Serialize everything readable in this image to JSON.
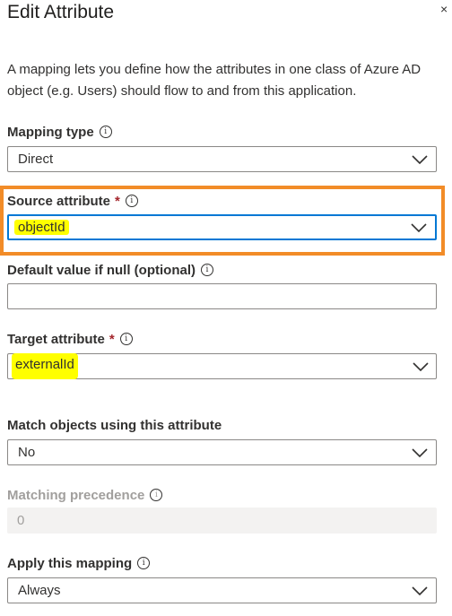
{
  "header": {
    "title": "Edit Attribute",
    "close_symbol": "×"
  },
  "description": "A mapping lets you define how the attributes in one class of Azure AD object (e.g. Users) should flow to and from this application.",
  "fields": {
    "mapping_type": {
      "label": "Mapping type",
      "value": "Direct"
    },
    "source_attribute": {
      "label": "Source attribute",
      "required_mark": "*",
      "value": "objectId"
    },
    "default_value": {
      "label": "Default value if null (optional)",
      "value": ""
    },
    "target_attribute": {
      "label": "Target attribute",
      "required_mark": "*",
      "value": "externalId"
    },
    "match_objects": {
      "label": "Match objects using this attribute",
      "value": "No"
    },
    "matching_precedence": {
      "label": "Matching precedence",
      "value": "0"
    },
    "apply_mapping": {
      "label": "Apply this mapping",
      "value": "Always"
    }
  },
  "info_icon_glyph": "i",
  "colors": {
    "accent": "#0078d4",
    "highlight": "#ffff00",
    "callout_border": "#f28c28",
    "required": "#a4262c"
  }
}
